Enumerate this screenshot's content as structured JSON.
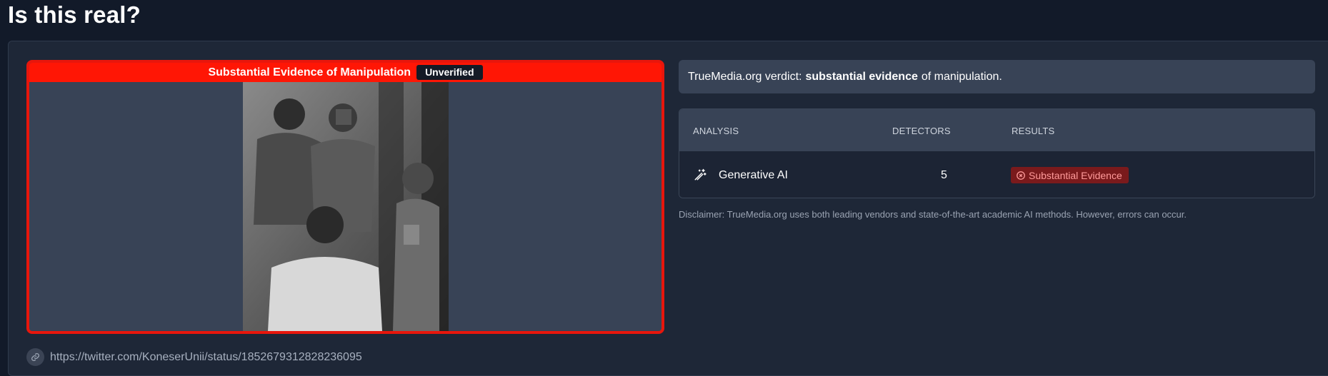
{
  "page": {
    "title": "Is this real?"
  },
  "media": {
    "verdict_label": "Substantial Evidence of Manipulation",
    "badge": "Unverified",
    "image_alt": "black and white photo of four people"
  },
  "source": {
    "url": "https://twitter.com/KoneserUnii/status/1852679312828236095",
    "icon": "link-icon"
  },
  "verdict": {
    "prefix": "TrueMedia.org verdict:",
    "emphasis": "substantial evidence",
    "suffix": "of manipulation."
  },
  "analysis_table": {
    "headers": {
      "analysis": "ANALYSIS",
      "detectors": "DETECTORS",
      "results": "RESULTS"
    },
    "rows": [
      {
        "icon": "magic-wand-icon",
        "name": "Generative AI",
        "detectors": "5",
        "result": "Substantial Evidence",
        "result_icon": "x-circle-icon"
      }
    ]
  },
  "disclaimer": "Disclaimer: TrueMedia.org uses both leading vendors and state-of-the-art academic AI methods. However, errors can occur.",
  "colors": {
    "background": "#121a29",
    "panel": "#1e2737",
    "manipulation_red": "#ff1605",
    "result_badge_bg": "#7a1a1c",
    "result_badge_text": "#ff9a9a"
  }
}
